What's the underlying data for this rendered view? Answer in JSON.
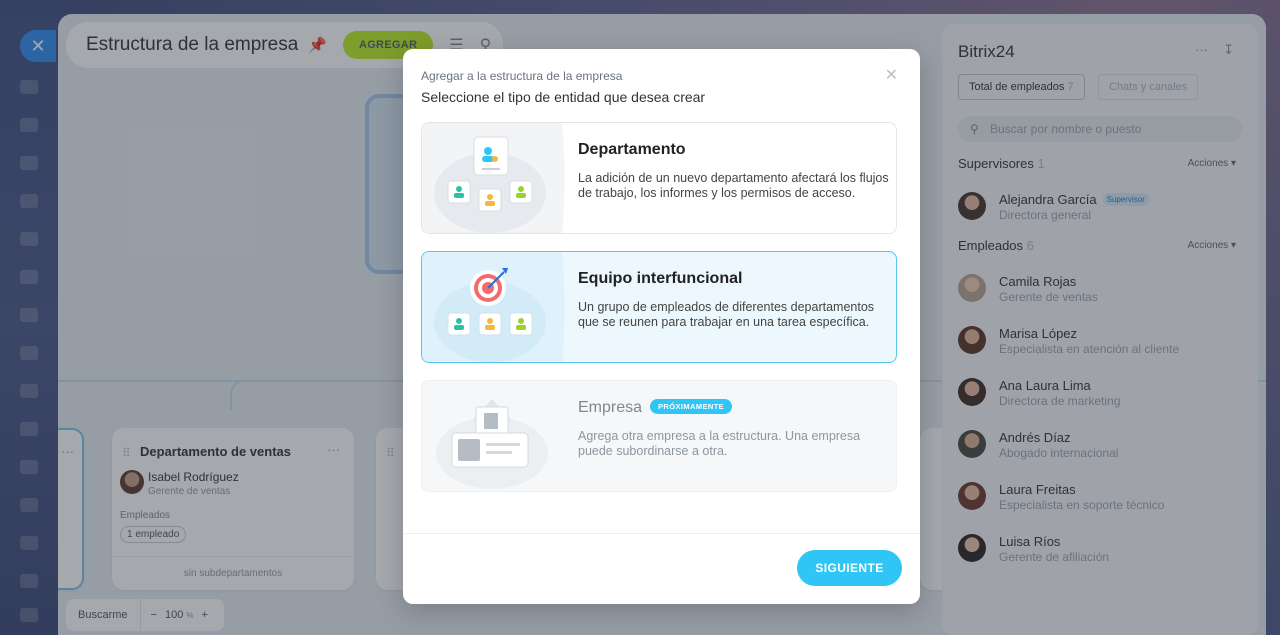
{
  "app": {
    "title": "Estructura de la empresa",
    "add_label": "AGREGAR"
  },
  "org_chart": {
    "cards": [
      {
        "title": "Departamento de ventas",
        "head_name": "Isabel Rodríguez",
        "head_role": "Gerente de ventas",
        "employees_label": "Empleados",
        "employees_count": "1 empleado",
        "footer": "sin subdepartamentos"
      }
    ]
  },
  "bottom_bar": {
    "find_label": "Buscarme",
    "zoom_minus": "−",
    "zoom_value": "100",
    "zoom_unit": "%",
    "zoom_plus": "+"
  },
  "panel": {
    "title": "Bitrix24",
    "tabs": [
      {
        "label": "Total de empleados",
        "count": "7",
        "active": true
      },
      {
        "label": "Chats y canales",
        "active": false
      }
    ],
    "search_placeholder": "Buscar por nombre o puesto",
    "supervisors": {
      "label": "Supervisores",
      "count": "1",
      "actions": "Acciones",
      "items": [
        {
          "name": "Alejandra García",
          "role": "Directora general",
          "badge": "Supervisor"
        }
      ]
    },
    "employees": {
      "label": "Empleados",
      "count": "6",
      "actions": "Acciones",
      "items": [
        {
          "name": "Camila Rojas",
          "role": "Gerente de ventas"
        },
        {
          "name": "Marisa López",
          "role": "Especialista en atención al cliente"
        },
        {
          "name": "Ana Laura Lima",
          "role": "Directora de marketing"
        },
        {
          "name": "Andrés Díaz",
          "role": "Abogado internacional"
        },
        {
          "name": "Laura Freitas",
          "role": "Especialista en soporte técnico"
        },
        {
          "name": "Luisa Ríos",
          "role": "Gerente de afiliación"
        }
      ]
    }
  },
  "modal": {
    "subtitle": "Agregar a la estructura de la empresa",
    "heading": "Seleccione el tipo de entidad que desea crear",
    "options": [
      {
        "title": "Departamento",
        "description": "La adición de un nuevo departamento afectará los flujos de trabajo, los informes y los permisos de acceso."
      },
      {
        "title": "Equipo interfuncional",
        "description": "Un grupo de empleados de diferentes departamentos que se reunen para trabajar en una tarea específica."
      },
      {
        "title": "Empresa",
        "badge": "PRÓXIMAMENTE",
        "description": "Agrega otra empresa a la estructura. Una empresa puede subordinarse a otra."
      }
    ],
    "next_label": "SIGUIENTE"
  },
  "colors": {
    "accent": "#2fc6f6",
    "add_button": "#bbed21",
    "selected_border": "#59c4ee"
  }
}
